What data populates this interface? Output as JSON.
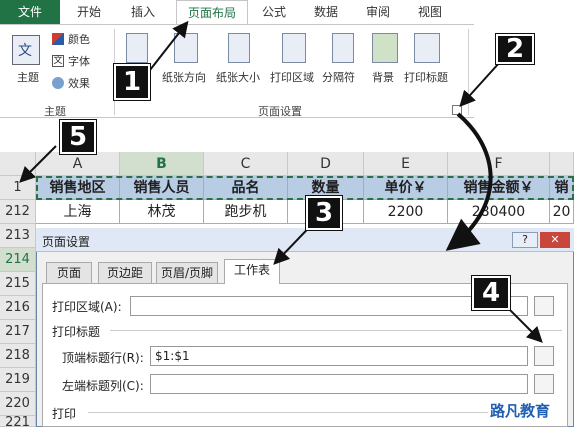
{
  "ribbon": {
    "tabs": [
      "文件",
      "开始",
      "插入",
      "页面布局",
      "公式",
      "数据",
      "审阅",
      "视图"
    ],
    "active_tab": "页面布局",
    "theme_group": {
      "theme": "主题",
      "colors": "颜色",
      "fonts": "字体",
      "effects": "效果",
      "label": "主题",
      "theme_icon_text": "文"
    },
    "page_setup_group": {
      "margins": "距",
      "orientation": "纸张方向",
      "size": "纸张大小",
      "print_area": "打印区域",
      "breaks": "分隔符",
      "background": "背景",
      "print_titles": "打印标题",
      "label": "页面设置"
    }
  },
  "callouts": [
    "1",
    "2",
    "3",
    "4",
    "5"
  ],
  "sheet": {
    "columns": [
      "A",
      "B",
      "C",
      "D",
      "E",
      "F"
    ],
    "rows": [
      "1",
      "212",
      "213",
      "214",
      "215",
      "216",
      "217",
      "218",
      "219",
      "220",
      "221"
    ],
    "header_row": [
      "销售地区",
      "销售人员",
      "品名",
      "数量",
      "单价￥",
      "销售金额￥",
      "销"
    ],
    "data_row": [
      "上海",
      "林茂",
      "跑步机",
      "",
      "2200",
      "280400",
      "20"
    ]
  },
  "dialog": {
    "title": "页面设置",
    "help": "?",
    "close": "✕",
    "tabs": [
      "页面",
      "页边距",
      "页眉/页脚",
      "工作表"
    ],
    "active_tab": "工作表",
    "print_area_label": "打印区域(A):",
    "print_titles_label": "打印标题",
    "rows_repeat_label": "顶端标题行(R):",
    "rows_repeat_value": "$1:$1",
    "cols_repeat_label": "左端标题列(C):",
    "print_label": "打印"
  },
  "watermark": "路凡教育",
  "colors": {
    "accent": "#217346",
    "header_fill": "#b8cce4",
    "dialog_close": "#c9463d"
  }
}
